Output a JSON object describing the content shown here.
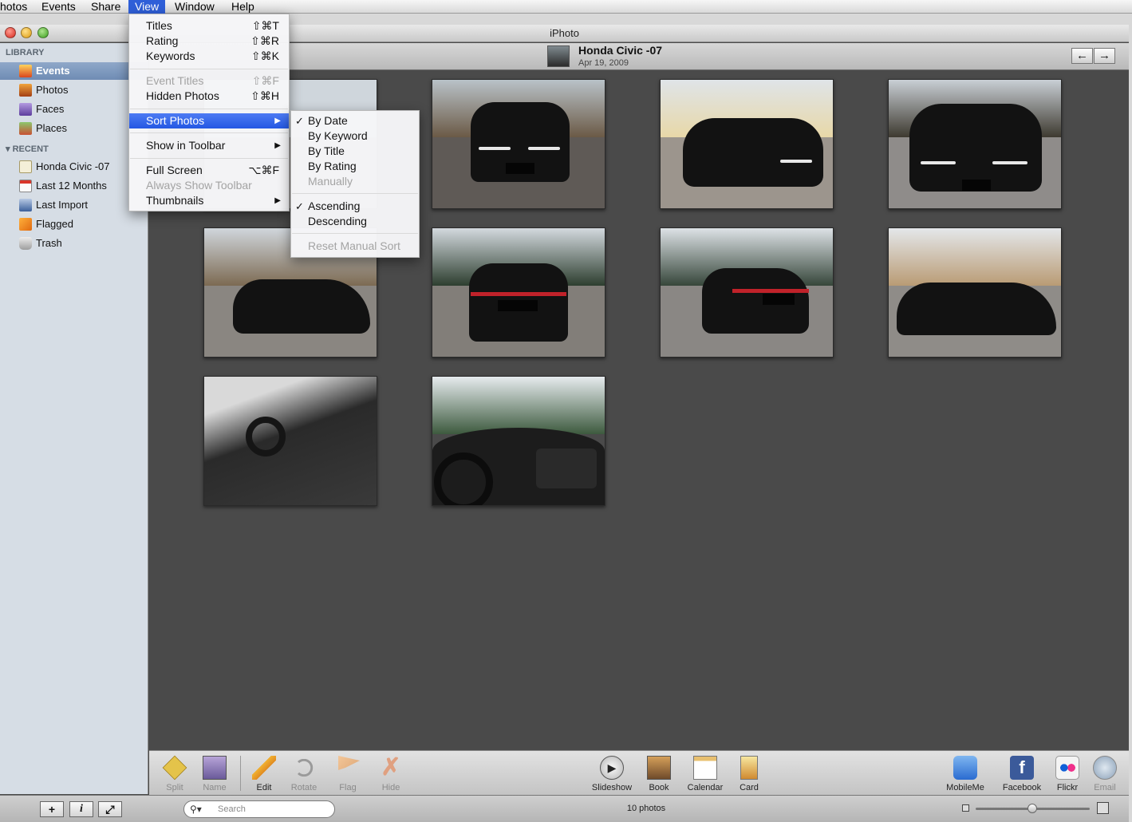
{
  "menubar": {
    "items": [
      "hotos",
      "Events",
      "Share",
      "View",
      "Window",
      "Help"
    ],
    "active": "View"
  },
  "window": {
    "title": "iPhoto"
  },
  "sidebar": {
    "library_header": "LIBRARY",
    "library_items": [
      {
        "label": "Events",
        "icon": "events-icon"
      },
      {
        "label": "Photos",
        "icon": "photos-icon"
      },
      {
        "label": "Faces",
        "icon": "faces-icon"
      },
      {
        "label": "Places",
        "icon": "places-icon"
      }
    ],
    "recent_header": "RECENT",
    "recent_items": [
      {
        "label": "Honda Civic -07",
        "icon": "event-icon"
      },
      {
        "label": "Last 12 Months",
        "icon": "calendar-icon"
      },
      {
        "label": "Last Import",
        "icon": "import-icon"
      },
      {
        "label": "Flagged",
        "icon": "flag-icon"
      },
      {
        "label": "Trash",
        "icon": "trash-icon"
      }
    ]
  },
  "event": {
    "title": "Honda Civic -07",
    "date": "Apr 19, 2009",
    "prev": "←",
    "next": "→"
  },
  "view_menu": {
    "items": [
      {
        "label": "Titles",
        "shortcut": "⇧⌘T"
      },
      {
        "label": "Rating",
        "shortcut": "⇧⌘R"
      },
      {
        "label": "Keywords",
        "shortcut": "⇧⌘K"
      },
      {
        "label": "Event Titles",
        "shortcut": "⇧⌘F"
      },
      {
        "label": "Hidden Photos",
        "shortcut": "⇧⌘H"
      },
      {
        "label": "Sort Photos",
        "shortcut": "▶"
      },
      {
        "label": "Show in Toolbar",
        "shortcut": "▶"
      },
      {
        "label": "Full Screen",
        "shortcut": "⌥⌘F"
      },
      {
        "label": "Always Show Toolbar",
        "shortcut": ""
      },
      {
        "label": "Thumbnails",
        "shortcut": "▶"
      }
    ]
  },
  "sort_menu": {
    "items": [
      "By Date",
      "By Keyword",
      "By Title",
      "By Rating",
      "Manually",
      "Ascending",
      "Descending",
      "Reset Manual Sort"
    ],
    "check": "✓"
  },
  "toolbar": {
    "left": [
      "Split",
      "Name",
      "Edit",
      "Rotate",
      "Flag",
      "Hide"
    ],
    "center": [
      "Slideshow",
      "Book",
      "Calendar",
      "Card"
    ],
    "right": [
      "MobileMe",
      "Facebook",
      "Flickr",
      "Email"
    ]
  },
  "status": {
    "search_placeholder": "Search",
    "photo_count": "10 photos",
    "add": "+",
    "info": "i",
    "fullscreen": "⤢"
  },
  "colors": {
    "menu_highlight": "#2f5fd8",
    "canvas": "#4a4a4a",
    "sidebar": "#d6dde5"
  }
}
